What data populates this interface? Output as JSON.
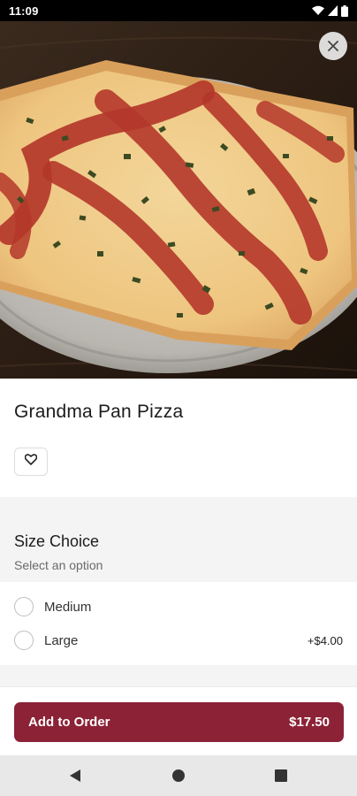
{
  "status_bar": {
    "time": "11:09",
    "icons": [
      "wifi-icon",
      "signal-icon",
      "battery-icon"
    ]
  },
  "hero": {
    "image": "pizza-photo",
    "close_icon": "close-icon"
  },
  "item": {
    "title": "Grandma Pan Pizza",
    "favorite_icon": "heart-outline-icon"
  },
  "option_group": {
    "title": "Size Choice",
    "subtitle": "Select an option",
    "options": [
      {
        "label": "Medium",
        "price": ""
      },
      {
        "label": "Large",
        "price": "+$4.00"
      }
    ]
  },
  "cart": {
    "add_label": "Add to Order",
    "price": "$17.50"
  },
  "nav": {
    "buttons": [
      "back-icon",
      "home-icon",
      "recents-icon"
    ]
  },
  "colors": {
    "accent": "#8c2236",
    "section_bg": "#f4f4f4"
  }
}
